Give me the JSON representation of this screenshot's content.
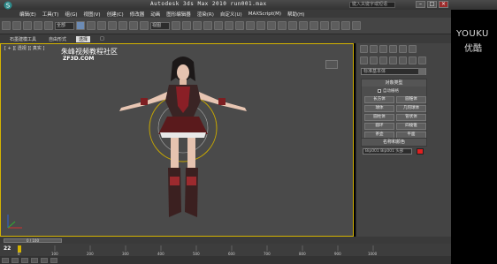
{
  "app": {
    "title": "Autodesk 3ds Max  2010   run001.max",
    "search_placeholder": "键入关键字或短语"
  },
  "menu": [
    "编辑(E)",
    "工具(T)",
    "组(G)",
    "视图(V)",
    "创建(C)",
    "修改器",
    "动画",
    "图形编辑器",
    "渲染(R)",
    "自定义(U)",
    "MAXScript(M)",
    "帮助(H)"
  ],
  "toolbar": {
    "selection_filter": "全部",
    "view_dropdown": "视图"
  },
  "tabs": [
    "石墨建模工具",
    "自由形式",
    "选择",
    "□"
  ],
  "viewport": {
    "label": "[ + ][ 透视 ][ 真实 ]",
    "watermark_cn": "朱峰视频教程社区",
    "watermark_url": "ZF3D.COM"
  },
  "command_panel": {
    "category_dropdown": "标准基本体",
    "object_type_title": "对象类型",
    "autogrid_label": "自动栅格",
    "object_buttons": [
      "长方体",
      "圆锥体",
      "球体",
      "几何球体",
      "圆柱体",
      "管状体",
      "圆环",
      "四棱锥",
      "茶壶",
      "平面"
    ],
    "name_color_title": "名称和颜色",
    "name_value": "Bip001 Bip001 头部"
  },
  "branding": {
    "en": "YOUKU",
    "cn": "优酷"
  },
  "timeline": {
    "slider": "0 / 100",
    "current_frame": "22",
    "ticks": [
      "0",
      "100",
      "200",
      "300",
      "400",
      "500",
      "600",
      "700",
      "800",
      "900",
      "1000"
    ]
  }
}
